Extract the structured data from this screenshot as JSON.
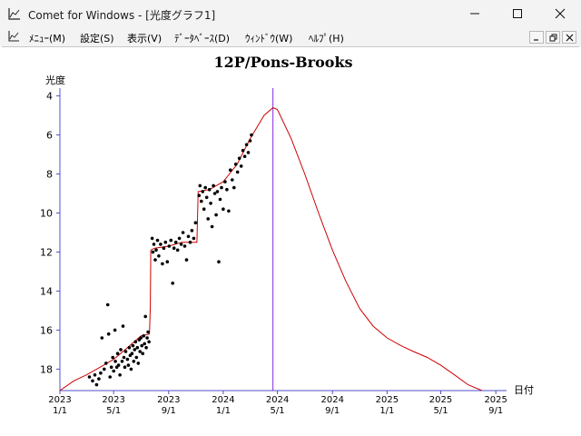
{
  "window": {
    "title": "Comet for Windows - [光度グラフ1]"
  },
  "menu": {
    "items": [
      "ﾒﾆｭｰ(M)",
      "設定(S)",
      "表示(V)",
      "ﾃﾞｰﾀﾍﾞｰｽ(D)",
      "ｳｨﾝﾄﾞｳ(W)",
      "ﾍﾙﾌﾟ(H)"
    ]
  },
  "icons": {
    "app": "chart-app-icon",
    "minimize": "minimize-icon",
    "maximize": "maximize-icon",
    "close": "close-icon"
  },
  "colors": {
    "titlebar_bg": "#f3f3f3",
    "axis": "#5050c8",
    "predicted_curve": "#cc0000",
    "observations": "#000000",
    "perihelion_line": "#8a2be2"
  },
  "chart_data": {
    "type": "scatter",
    "title": "12P/Pons-Brooks",
    "ylabel": "光度",
    "xlabel": "日付",
    "y_inverted": true,
    "ylim": [
      19.1,
      3.6
    ],
    "y_ticks": [
      4,
      6,
      8,
      10,
      12,
      14,
      16,
      18
    ],
    "xlim": [
      "2023-01-01",
      "2025-09-25"
    ],
    "x_ticks": [
      {
        "date": "2023-01-01",
        "year": "2023",
        "md": "1/1"
      },
      {
        "date": "2023-05-01",
        "year": "2023",
        "md": "5/1"
      },
      {
        "date": "2023-09-01",
        "year": "2023",
        "md": "9/1"
      },
      {
        "date": "2024-01-01",
        "year": "2024",
        "md": "1/1"
      },
      {
        "date": "2024-05-01",
        "year": "2024",
        "md": "5/1"
      },
      {
        "date": "2024-09-01",
        "year": "2024",
        "md": "9/1"
      },
      {
        "date": "2025-01-01",
        "year": "2025",
        "md": "1/1"
      },
      {
        "date": "2025-05-01",
        "year": "2025",
        "md": "5/1"
      },
      {
        "date": "2025-09-01",
        "year": "2025",
        "md": "9/1"
      }
    ],
    "perihelion_date": "2024-04-21",
    "series": [
      {
        "kind": "line",
        "points": [
          [
            "2023-01-01",
            19.1
          ],
          [
            "2023-02-01",
            18.6
          ],
          [
            "2023-03-01",
            18.3
          ],
          [
            "2023-04-01",
            17.9
          ],
          [
            "2023-05-01",
            17.5
          ],
          [
            "2023-06-01",
            16.9
          ],
          [
            "2023-07-01",
            16.3
          ],
          [
            "2023-07-20",
            16.2
          ],
          [
            "2023-07-22",
            14.8
          ],
          [
            "2023-07-23",
            11.9
          ],
          [
            "2023-08-01",
            11.8
          ],
          [
            "2023-09-01",
            11.7
          ],
          [
            "2023-10-01",
            11.5
          ],
          [
            "2023-11-03",
            11.5
          ],
          [
            "2023-11-06",
            8.9
          ],
          [
            "2023-12-01",
            8.8
          ],
          [
            "2024-01-01",
            8.4
          ],
          [
            "2024-02-01",
            7.5
          ],
          [
            "2024-03-01",
            6.2
          ],
          [
            "2024-04-01",
            5.0
          ],
          [
            "2024-04-21",
            4.6
          ],
          [
            "2024-05-01",
            4.7
          ],
          [
            "2024-06-01",
            6.2
          ],
          [
            "2024-07-01",
            8.0
          ],
          [
            "2024-08-01",
            10.0
          ],
          [
            "2024-09-01",
            11.9
          ],
          [
            "2024-10-01",
            13.5
          ],
          [
            "2024-11-01",
            14.9
          ],
          [
            "2024-12-01",
            15.8
          ],
          [
            "2025-01-01",
            16.4
          ],
          [
            "2025-02-01",
            16.8
          ],
          [
            "2025-03-01",
            17.1
          ],
          [
            "2025-04-01",
            17.4
          ],
          [
            "2025-05-01",
            17.8
          ],
          [
            "2025-06-01",
            18.3
          ],
          [
            "2025-07-01",
            18.8
          ],
          [
            "2025-08-01",
            19.1
          ]
        ]
      },
      {
        "kind": "scatter",
        "points": [
          [
            "2023-03-08",
            18.4
          ],
          [
            "2023-03-15",
            18.6
          ],
          [
            "2023-03-20",
            18.3
          ],
          [
            "2023-03-24",
            18.8
          ],
          [
            "2023-03-29",
            18.5
          ],
          [
            "2023-04-02",
            18.2
          ],
          [
            "2023-04-05",
            16.4
          ],
          [
            "2023-04-10",
            18.0
          ],
          [
            "2023-04-14",
            17.7
          ],
          [
            "2023-04-18",
            14.7
          ],
          [
            "2023-04-20",
            16.2
          ],
          [
            "2023-04-23",
            18.4
          ],
          [
            "2023-04-26",
            17.9
          ],
          [
            "2023-04-29",
            17.4
          ],
          [
            "2023-05-01",
            18.1
          ],
          [
            "2023-05-04",
            16.0
          ],
          [
            "2023-05-05",
            17.6
          ],
          [
            "2023-05-08",
            17.9
          ],
          [
            "2023-05-10",
            17.2
          ],
          [
            "2023-05-12",
            17.8
          ],
          [
            "2023-05-15",
            18.3
          ],
          [
            "2023-05-17",
            17.0
          ],
          [
            "2023-05-20",
            17.6
          ],
          [
            "2023-05-22",
            15.8
          ],
          [
            "2023-05-24",
            17.4
          ],
          [
            "2023-05-26",
            17.9
          ],
          [
            "2023-05-28",
            17.1
          ],
          [
            "2023-06-01",
            17.5
          ],
          [
            "2023-06-03",
            17.8
          ],
          [
            "2023-06-05",
            16.9
          ],
          [
            "2023-06-07",
            17.3
          ],
          [
            "2023-06-09",
            18.0
          ],
          [
            "2023-06-11",
            17.2
          ],
          [
            "2023-06-13",
            16.8
          ],
          [
            "2023-06-15",
            17.6
          ],
          [
            "2023-06-17",
            17.0
          ],
          [
            "2023-06-19",
            16.6
          ],
          [
            "2023-06-21",
            17.4
          ],
          [
            "2023-06-23",
            16.9
          ],
          [
            "2023-06-25",
            17.7
          ],
          [
            "2023-06-27",
            16.5
          ],
          [
            "2023-06-29",
            17.1
          ],
          [
            "2023-07-01",
            16.4
          ],
          [
            "2023-07-03",
            16.8
          ],
          [
            "2023-07-05",
            17.2
          ],
          [
            "2023-07-07",
            16.3
          ],
          [
            "2023-07-09",
            16.7
          ],
          [
            "2023-07-11",
            15.3
          ],
          [
            "2023-07-13",
            16.9
          ],
          [
            "2023-07-15",
            16.4
          ],
          [
            "2023-07-17",
            16.1
          ],
          [
            "2023-07-19",
            16.6
          ],
          [
            "2023-07-26",
            11.3
          ],
          [
            "2023-07-28",
            12.0
          ],
          [
            "2023-07-30",
            11.6
          ],
          [
            "2023-08-02",
            12.4
          ],
          [
            "2023-08-04",
            11.9
          ],
          [
            "2023-08-07",
            11.4
          ],
          [
            "2023-08-10",
            12.2
          ],
          [
            "2023-08-14",
            11.6
          ],
          [
            "2023-08-18",
            12.6
          ],
          [
            "2023-08-21",
            11.8
          ],
          [
            "2023-08-25",
            11.5
          ],
          [
            "2023-08-29",
            12.5
          ],
          [
            "2023-09-02",
            11.7
          ],
          [
            "2023-09-06",
            11.4
          ],
          [
            "2023-09-10",
            13.6
          ],
          [
            "2023-09-13",
            11.8
          ],
          [
            "2023-09-17",
            11.5
          ],
          [
            "2023-09-21",
            11.9
          ],
          [
            "2023-09-25",
            11.3
          ],
          [
            "2023-09-29",
            11.6
          ],
          [
            "2023-10-03",
            11.0
          ],
          [
            "2023-10-07",
            11.7
          ],
          [
            "2023-10-11",
            12.4
          ],
          [
            "2023-10-15",
            11.2
          ],
          [
            "2023-10-19",
            11.5
          ],
          [
            "2023-10-23",
            10.9
          ],
          [
            "2023-10-27",
            11.3
          ],
          [
            "2023-10-31",
            10.5
          ],
          [
            "2023-11-08",
            9.1
          ],
          [
            "2023-11-10",
            8.6
          ],
          [
            "2023-11-13",
            9.4
          ],
          [
            "2023-11-16",
            8.9
          ],
          [
            "2023-11-19",
            9.8
          ],
          [
            "2023-11-22",
            8.7
          ],
          [
            "2023-11-25",
            9.2
          ],
          [
            "2023-11-28",
            10.3
          ],
          [
            "2023-12-01",
            8.8
          ],
          [
            "2023-12-04",
            9.5
          ],
          [
            "2023-12-07",
            10.7
          ],
          [
            "2023-12-10",
            8.6
          ],
          [
            "2023-12-13",
            9.0
          ],
          [
            "2023-12-16",
            10.1
          ],
          [
            "2023-12-19",
            8.9
          ],
          [
            "2023-12-22",
            12.5
          ],
          [
            "2023-12-25",
            9.3
          ],
          [
            "2023-12-28",
            8.7
          ],
          [
            "2024-01-01",
            9.8
          ],
          [
            "2024-01-05",
            8.4
          ],
          [
            "2024-01-09",
            8.8
          ],
          [
            "2024-01-13",
            9.9
          ],
          [
            "2024-01-17",
            7.8
          ],
          [
            "2024-01-21",
            8.3
          ],
          [
            "2024-01-25",
            8.7
          ],
          [
            "2024-01-29",
            7.5
          ],
          [
            "2024-02-02",
            7.9
          ],
          [
            "2024-02-06",
            7.2
          ],
          [
            "2024-02-10",
            7.6
          ],
          [
            "2024-02-14",
            6.8
          ],
          [
            "2024-02-18",
            7.1
          ],
          [
            "2024-02-22",
            6.5
          ],
          [
            "2024-02-26",
            6.9
          ],
          [
            "2024-03-01",
            6.3
          ],
          [
            "2024-03-04",
            6.0
          ]
        ]
      }
    ]
  }
}
